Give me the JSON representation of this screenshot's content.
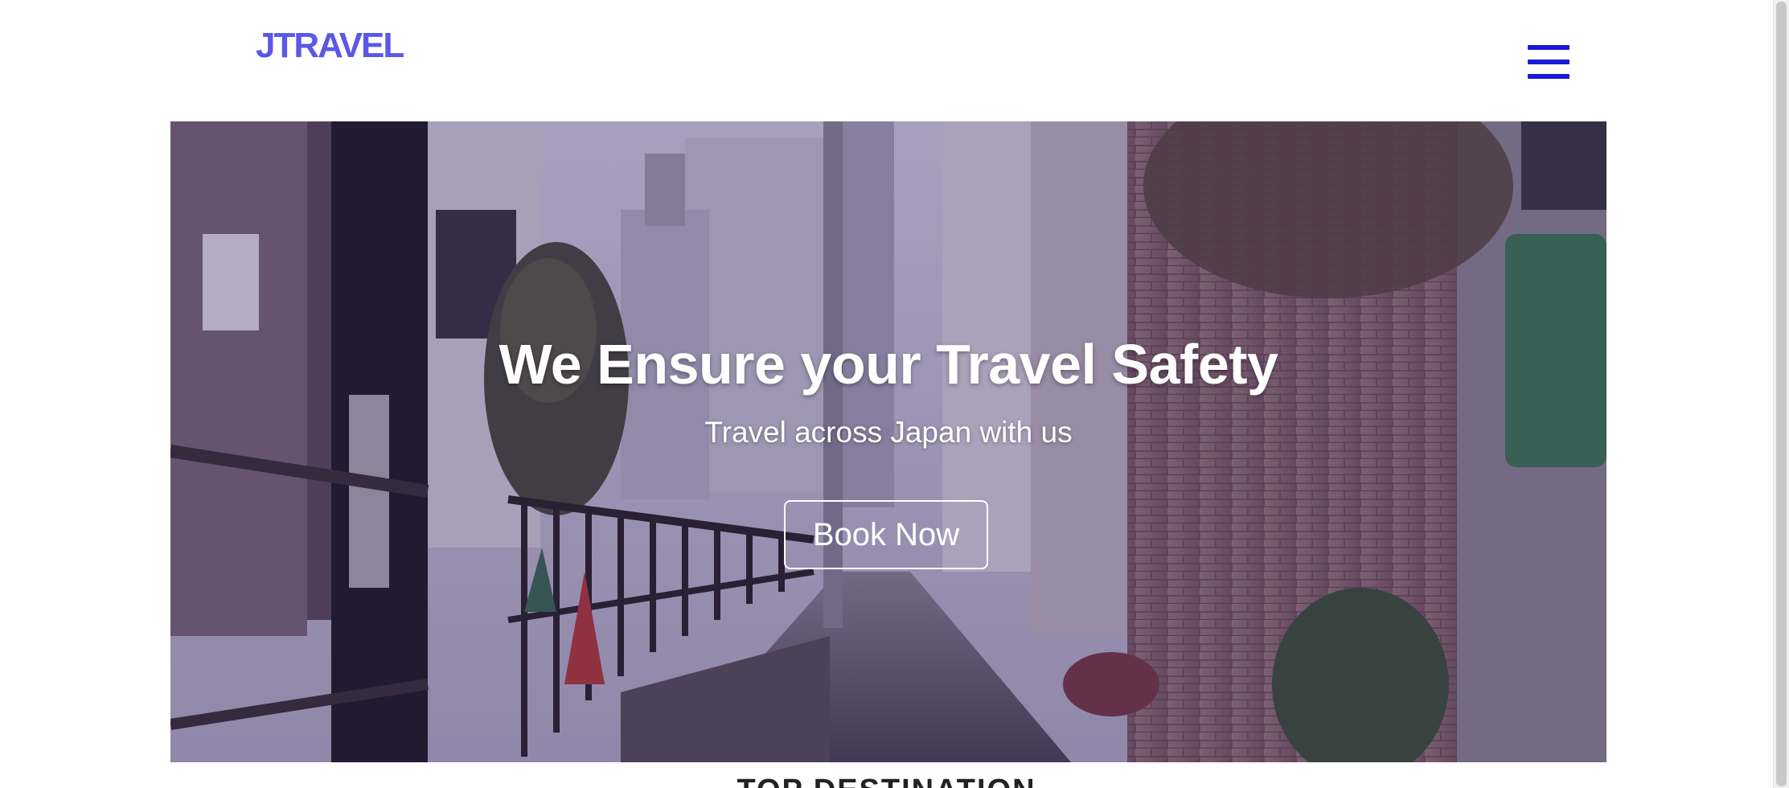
{
  "navbar": {
    "brand": "JTRAVEL",
    "menu_icon": "hamburger-menu-icon"
  },
  "hero": {
    "background_image": "japanese-street-alley-photo",
    "title": "We Ensure your Travel Safety",
    "subtitle": "Travel across Japan with us",
    "cta_label": "Book Now"
  },
  "next_section": {
    "heading": "TOP DESTINATION"
  },
  "colors": {
    "brand": "#5b58e8",
    "menu_icon": "#1a1ad6",
    "hero_text": "#ffffff"
  }
}
